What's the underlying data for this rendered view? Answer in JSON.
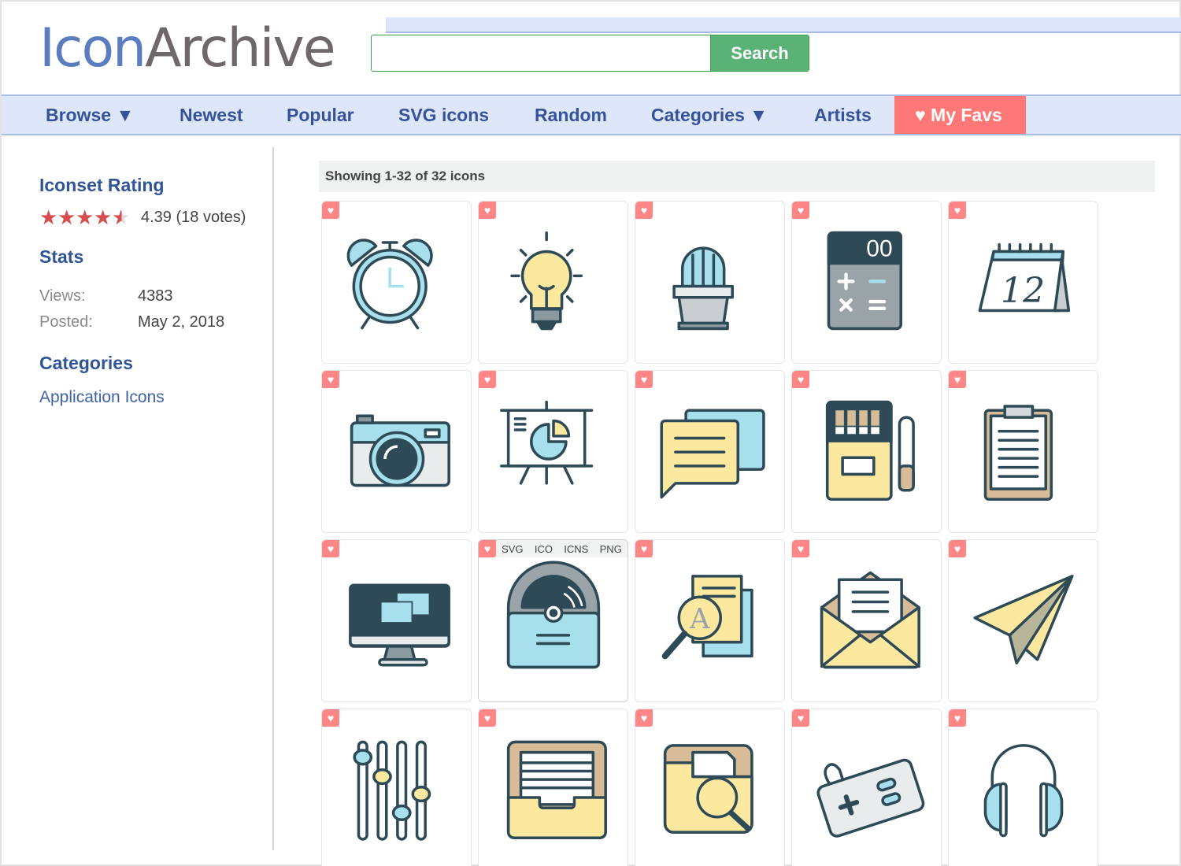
{
  "header": {
    "logo_icon": "Icon",
    "logo_archive": "Archive",
    "search_placeholder": "",
    "search_value": "",
    "search_button": "Search"
  },
  "nav": {
    "items": [
      {
        "label": "Browse ▼"
      },
      {
        "label": "Newest"
      },
      {
        "label": "Popular"
      },
      {
        "label": "SVG icons"
      },
      {
        "label": "Random"
      },
      {
        "label": "Categories ▼"
      },
      {
        "label": "Artists"
      },
      {
        "label": "♥ My Favs"
      }
    ]
  },
  "sidebar": {
    "rating_heading": "Iconset Rating",
    "rating_value": 4.39,
    "rating_text": "4.39 (18 votes)",
    "stars_max": 5,
    "stats_heading": "Stats",
    "stats": [
      {
        "label": "Views:",
        "value": "4383"
      },
      {
        "label": "Posted:",
        "value": "May 2, 2018"
      }
    ],
    "categories_heading": "Categories",
    "categories": [
      {
        "label": "Application Icons"
      }
    ]
  },
  "main": {
    "showing_text": "Showing 1-32 of 32 icons",
    "fav_glyph": "♥",
    "format_links": [
      "SVG",
      "ICO",
      "ICNS",
      "PNG"
    ],
    "hovered_index": 11,
    "icons": [
      {
        "name": "alarm-clock"
      },
      {
        "name": "light-bulb"
      },
      {
        "name": "cactus"
      },
      {
        "name": "calculator",
        "display_text": "00"
      },
      {
        "name": "calendar",
        "display_text": "12"
      },
      {
        "name": "camera"
      },
      {
        "name": "presentation"
      },
      {
        "name": "chat-bubbles"
      },
      {
        "name": "cigarettes"
      },
      {
        "name": "clipboard"
      },
      {
        "name": "desktop"
      },
      {
        "name": "disk-drive"
      },
      {
        "name": "document-search",
        "display_text": "A"
      },
      {
        "name": "envelope"
      },
      {
        "name": "paper-plane"
      },
      {
        "name": "equalizer"
      },
      {
        "name": "file-drawer"
      },
      {
        "name": "folder-search"
      },
      {
        "name": "gamepad"
      },
      {
        "name": "headphones"
      }
    ]
  },
  "colors": {
    "brand_blue": "#5b7dbf",
    "brand_gray": "#6e6868",
    "nav_bg": "#dde7f9",
    "nav_text": "#35529a",
    "favs_bg": "#ff7878",
    "search_green": "#5ab276",
    "star_red": "#d84d4d",
    "heading_blue": "#2f5597",
    "icon_dark": "#2e4a57",
    "icon_blue": "#a8dfec",
    "icon_yellow": "#fde8a0"
  }
}
